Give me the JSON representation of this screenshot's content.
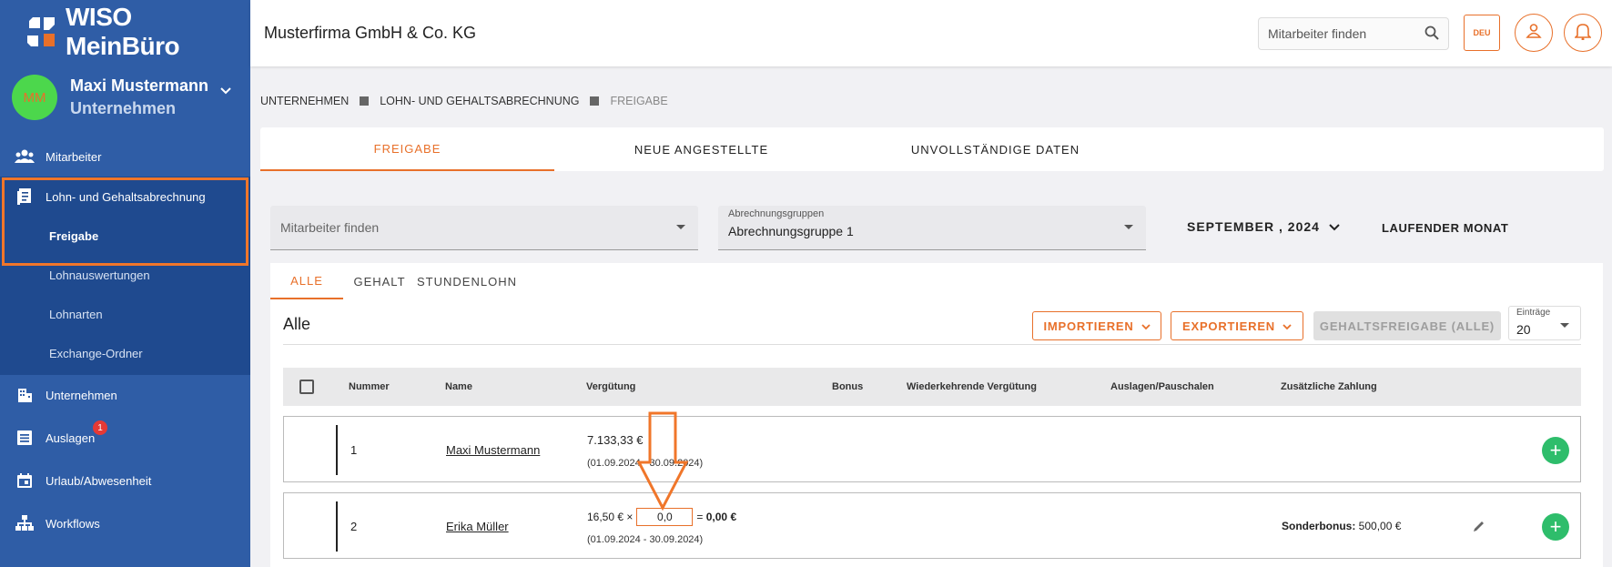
{
  "app": {
    "logo_text": "WISO MeinBüro"
  },
  "user": {
    "initials": "MM",
    "name": "Maxi Mustermann",
    "subtitle": "Unternehmen"
  },
  "sidebar": {
    "items": [
      {
        "label": "Mitarbeiter",
        "icon": "people-icon"
      },
      {
        "label": "Lohn- und Gehaltsabrechnung",
        "icon": "payroll-icon"
      },
      {
        "label": "Unternehmen",
        "icon": "building-icon"
      },
      {
        "label": "Auslagen",
        "icon": "receipt-icon",
        "badge": "1"
      },
      {
        "label": "Urlaub/Abwesenheit",
        "icon": "calendar-icon"
      },
      {
        "label": "Workflows",
        "icon": "workflow-icon"
      }
    ],
    "subitems": [
      "Freigabe",
      "Lohnauswertungen",
      "Lohnarten",
      "Exchange-Ordner"
    ]
  },
  "header": {
    "company": "Musterfirma GmbH & Co. KG",
    "search_placeholder": "Mitarbeiter finden",
    "lang": "DEU"
  },
  "breadcrumb": [
    "UNTERNEHMEN",
    "LOHN- UND GEHALTSABRECHNUNG",
    "FREIGABE"
  ],
  "top_tabs": [
    "FREIGABE",
    "NEUE ANGESTELLTE",
    "UNVOLLSTÄNDIGE DATEN"
  ],
  "filters": {
    "employee_placeholder": "Mitarbeiter finden",
    "group_label": "Abrechnungsgruppen",
    "group_value": "Abrechnungsgruppe 1",
    "month": "SEPTEMBER , 2024",
    "current_month": "LAUFENDER MONAT"
  },
  "sub_tabs": [
    "ALLE",
    "GEHALT",
    "STUNDENLOHN"
  ],
  "section": {
    "title": "Alle",
    "import_label": "IMPORTIEREN",
    "export_label": "EXPORTIEREN",
    "release_all_label": "GEHALTSFREIGABE (ALLE)",
    "entries_label": "Einträge",
    "entries_value": "20"
  },
  "table": {
    "headers": [
      "Nummer",
      "Name",
      "Vergütung",
      "Bonus",
      "Wiederkehrende Vergütung",
      "Auslagen/Pauschalen",
      "Zusätzliche Zahlung"
    ],
    "rows": [
      {
        "number": "1",
        "name": "Maxi Mustermann",
        "pay": "7.133,33 €",
        "period": "(01.09.2024 - 30.09.2024)"
      },
      {
        "number": "2",
        "name": "Erika Müller",
        "rate": "16,50 € ×",
        "hours": "0,0",
        "result_prefix": "=",
        "result": "0,00 €",
        "period": "(01.09.2024 - 30.09.2024)",
        "extra_label": "Sonderbonus:",
        "extra_value": "500,00 €"
      }
    ]
  },
  "colors": {
    "sidebar": "#2f5da6",
    "accent": "#e8702a",
    "add": "#2ebd6b"
  }
}
